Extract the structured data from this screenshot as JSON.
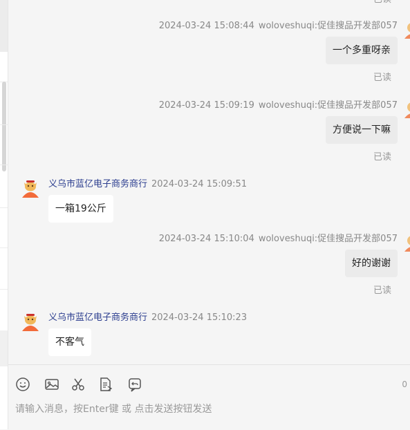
{
  "messages": [
    {
      "dir": "out",
      "time": "2024-03-24 15:08:44",
      "sender": "woloveshuqi:促佳搜品开发部057",
      "text": "一个多重呀亲",
      "status": "已读"
    },
    {
      "dir": "out",
      "time": "2024-03-24 15:09:19",
      "sender": "woloveshuqi:促佳搜品开发部057",
      "text": "方便说一下嘛",
      "status": "已读"
    },
    {
      "dir": "in",
      "time": "2024-03-24 15:09:51",
      "sender": "义乌市蓝亿电子商务商行",
      "text": "一箱19公斤"
    },
    {
      "dir": "out",
      "time": "2024-03-24 15:10:04",
      "sender": "woloveshuqi:促佳搜品开发部057",
      "text": "好的谢谢",
      "status": "已读"
    },
    {
      "dir": "in",
      "time": "2024-03-24 15:10:23",
      "sender": "义乌市蓝亿电子商务商行",
      "text": "不客气"
    }
  ],
  "composer": {
    "placeholder": "请输入消息，按Enter键 或 点击发送按钮发送",
    "char_count": "0",
    "tools": [
      "emoji-icon",
      "image-icon",
      "scissors-icon",
      "document-icon",
      "history-icon"
    ]
  },
  "colors": {
    "sender_in": "#2c3e8f",
    "bubble_out": "#ebebeb",
    "bubble_in": "#ffffff",
    "background": "#f5f5f5"
  }
}
